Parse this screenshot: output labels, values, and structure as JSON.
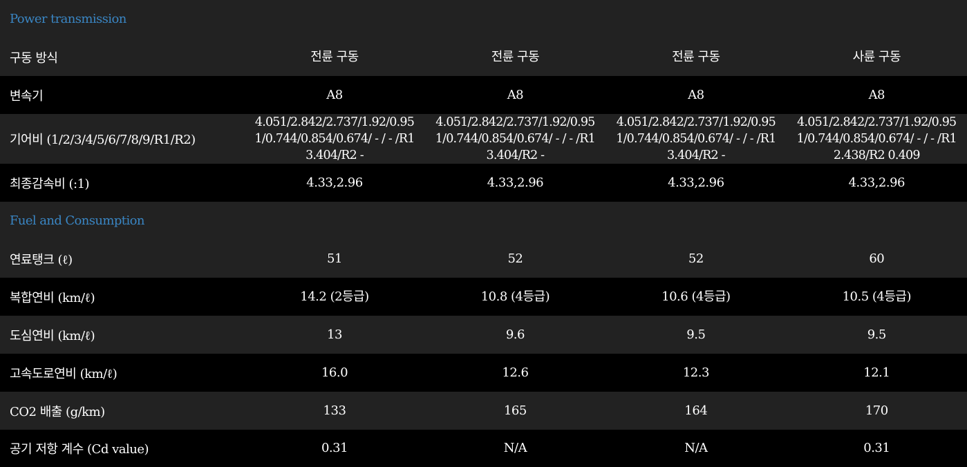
{
  "colors": {
    "section_title": "#3a86c4",
    "row_dark": "#222222",
    "row_black": "#000000",
    "text": "#ffffff"
  },
  "sections": [
    {
      "title": "Power transmission",
      "rows": [
        {
          "label": "구동 방식",
          "values": [
            "전륜 구동",
            "전륜 구동",
            "전륜 구동",
            "사륜 구동"
          ]
        },
        {
          "label": "변속기",
          "values": [
            "A8",
            "A8",
            "A8",
            "A8"
          ]
        },
        {
          "label": "기어비 (1/2/3/4/5/6/7/8/9/R1/R2)",
          "values": [
            "4.051/2.842/2.737/1.92/0.95\n1/0.744/0.854/0.674/ - / - /R1\n3.404/R2 -",
            "4.051/2.842/2.737/1.92/0.95\n1/0.744/0.854/0.674/ - / - /R1\n3.404/R2 -",
            "4.051/2.842/2.737/1.92/0.95\n1/0.744/0.854/0.674/ - / - /R1\n3.404/R2 -",
            "4.051/2.842/2.737/1.92/0.95\n1/0.744/0.854/0.674/ - / - /R1\n2.438/R2 0.409"
          ]
        },
        {
          "label": "최종감속비 (:1)",
          "values": [
            "4.33,2.96",
            "4.33,2.96",
            "4.33,2.96",
            "4.33,2.96"
          ]
        }
      ]
    },
    {
      "title": "Fuel and Consumption",
      "rows": [
        {
          "label": "연료탱크 (ℓ)",
          "values": [
            "51",
            "52",
            "52",
            "60"
          ]
        },
        {
          "label": "복합연비 (km/ℓ)",
          "values": [
            "14.2 (2등급)",
            "10.8 (4등급)",
            "10.6 (4등급)",
            "10.5 (4등급)"
          ]
        },
        {
          "label": "도심연비 (km/ℓ)",
          "values": [
            "13",
            "9.6",
            "9.5",
            "9.5"
          ]
        },
        {
          "label": "고속도로연비 (km/ℓ)",
          "values": [
            "16.0",
            "12.6",
            "12.3",
            "12.1"
          ]
        },
        {
          "label": "CO2 배출 (g/km)",
          "values": [
            "133",
            "165",
            "164",
            "170"
          ]
        },
        {
          "label": "공기 저항 계수 (Cd value)",
          "values": [
            "0.31",
            "N/A",
            "N/A",
            "0.31"
          ]
        }
      ]
    }
  ]
}
